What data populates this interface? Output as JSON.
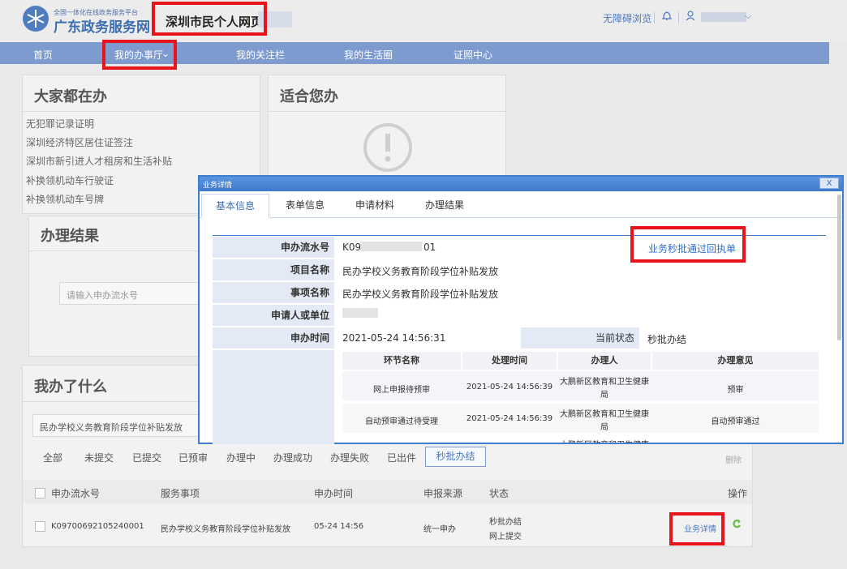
{
  "header": {
    "logo_sub": "全国一体化在线政务服务平台",
    "logo_title": "广东政务服务网",
    "page_name": "深圳市民个人网页",
    "accessibility": "无障碍浏览"
  },
  "nav": [
    "首页",
    "我的办事厅",
    "我的关注栏",
    "我的生活圈",
    "证照中心"
  ],
  "popular": {
    "title": "大家都在办",
    "items": [
      "无犯罪记录证明",
      "深圳经济特区居住证签注",
      "深圳市新引进人才租房和生活补贴",
      "补换领机动车行驶证",
      "补换领机动车号牌"
    ]
  },
  "suitable": {
    "title": "适合您办"
  },
  "result": {
    "title": "办理结果",
    "placeholder": "请输入申办流水号"
  },
  "done": {
    "title": "我办了什么",
    "search_value": "民办学校义务教育阶段学位补贴发放",
    "filters": [
      "全部",
      "未提交",
      "已提交",
      "已预审",
      "办理中",
      "办理成功",
      "办理失败",
      "已出件",
      "秒批办结"
    ],
    "delete_label": "删除",
    "columns": [
      "申办流水号",
      "服务事项",
      "申办时间",
      "申报来源",
      "状态",
      "操作"
    ],
    "row": {
      "serial": "K0970069210524000​1",
      "service": "民办学校义务教育阶段学位补贴发放",
      "time": "05-24 14:56",
      "source": "统一申办",
      "status1": "秒批办结",
      "status2": "网上提交",
      "action": "业务详情"
    }
  },
  "modal": {
    "title": "业务详情",
    "close": "X",
    "tabs": [
      "基本信息",
      "表单信息",
      "申请材料",
      "办理结果"
    ],
    "receipt_link": "业务秒批通过回执单",
    "fields": {
      "serial_label": "申办流水号",
      "serial_pre": "K09",
      "serial_post": "01",
      "project_label": "项目名称",
      "project": "民办学校义务教育阶段学位补贴发放",
      "item_label": "事项名称",
      "item": "民办学校义务教育阶段学位补贴发放",
      "applicant_label": "申请人或单位",
      "time_label": "申办时间",
      "time": "2021-05-24 14:56:31",
      "status_label": "当前状态",
      "status": "秒批办结"
    },
    "process_columns": [
      "环节名称",
      "处理时间",
      "办理人",
      "办理意见"
    ],
    "process_rows": [
      {
        "step": "网上申报待预审",
        "time": "2021-05-24 14:56:39",
        "handler1": "大鹏新区教育和卫生健康",
        "handler2": "局",
        "opinion": "预审"
      },
      {
        "step": "自动预审通过待受理",
        "time": "2021-05-24 14:56:39",
        "handler1": "大鹏新区教育和卫生健康",
        "handler2": "局",
        "opinion": "自动预审通过"
      },
      {
        "handler1": "大鹏新区教育和卫生健康"
      }
    ]
  }
}
